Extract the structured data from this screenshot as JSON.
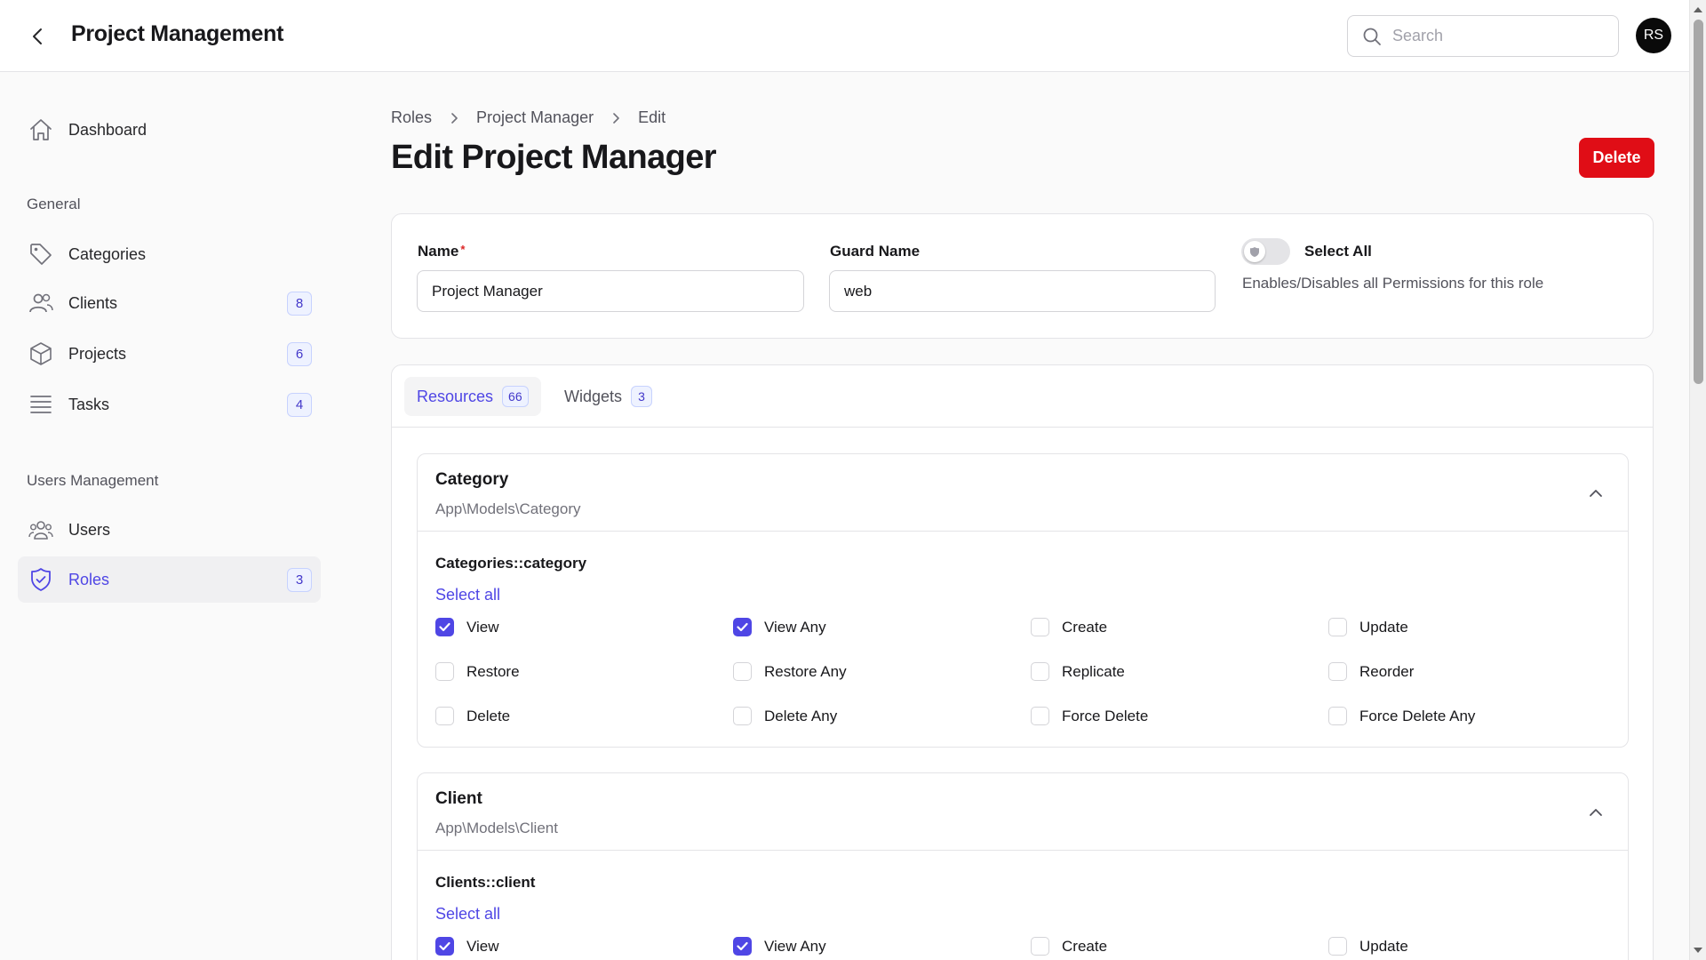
{
  "topbar": {
    "title": "Project Management",
    "search_placeholder": "Search",
    "avatar_initials": "RS"
  },
  "sidebar": {
    "dashboard": "Dashboard",
    "groups": [
      {
        "label": "General",
        "items": [
          {
            "label": "Categories",
            "icon": "tag-icon",
            "badge": ""
          },
          {
            "label": "Clients",
            "icon": "users-icon",
            "badge": "8"
          },
          {
            "label": "Projects",
            "icon": "cube-icon",
            "badge": "6"
          },
          {
            "label": "Tasks",
            "icon": "list-icon",
            "badge": "4"
          }
        ]
      },
      {
        "label": "Users Management",
        "items": [
          {
            "label": "Users",
            "icon": "user-group-icon",
            "badge": ""
          },
          {
            "label": "Roles",
            "icon": "shield-check-icon",
            "badge": "3",
            "active": true
          }
        ]
      }
    ]
  },
  "breadcrumb": [
    "Roles",
    "Project Manager",
    "Edit"
  ],
  "page": {
    "title": "Edit Project Manager",
    "delete_label": "Delete"
  },
  "form": {
    "name_label": "Name",
    "name_required": "*",
    "name_value": "Project Manager",
    "guard_label": "Guard Name",
    "guard_value": "web",
    "select_all_label": "Select All",
    "select_all_help": "Enables/Disables all Permissions for this role",
    "select_all_on": false
  },
  "tabs": [
    {
      "label": "Resources",
      "badge": "66",
      "active": true
    },
    {
      "label": "Widgets",
      "badge": "3",
      "active": false
    }
  ],
  "resources": [
    {
      "title": "Category",
      "model": "App\\Models\\Category",
      "group": "Categories::category",
      "select_all": "Select all",
      "permissions": [
        {
          "label": "View",
          "checked": true
        },
        {
          "label": "View Any",
          "checked": true
        },
        {
          "label": "Create",
          "checked": false
        },
        {
          "label": "Update",
          "checked": false
        },
        {
          "label": "Restore",
          "checked": false
        },
        {
          "label": "Restore Any",
          "checked": false
        },
        {
          "label": "Replicate",
          "checked": false
        },
        {
          "label": "Reorder",
          "checked": false
        },
        {
          "label": "Delete",
          "checked": false
        },
        {
          "label": "Delete Any",
          "checked": false
        },
        {
          "label": "Force Delete",
          "checked": false
        },
        {
          "label": "Force Delete Any",
          "checked": false
        }
      ]
    },
    {
      "title": "Client",
      "model": "App\\Models\\Client",
      "group": "Clients::client",
      "select_all": "Select all",
      "permissions": [
        {
          "label": "View",
          "checked": true
        },
        {
          "label": "View Any",
          "checked": true
        },
        {
          "label": "Create",
          "checked": false
        },
        {
          "label": "Update",
          "checked": false
        }
      ]
    }
  ],
  "colors": {
    "accent": "#4f46e5",
    "danger": "#e00d16",
    "badge_bg": "#eef2ff"
  }
}
